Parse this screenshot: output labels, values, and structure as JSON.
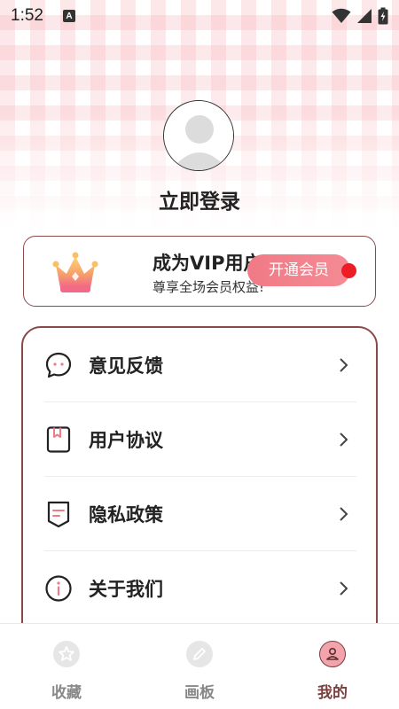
{
  "status_bar": {
    "time": "1:52",
    "notification_icon": "text-a-icon",
    "icons": [
      "wifi-icon",
      "signal-icon",
      "battery-charging-icon"
    ]
  },
  "profile": {
    "avatar_icon": "default-avatar-icon",
    "login_label": "立即登录"
  },
  "vip_card": {
    "title": "成为VIP用户",
    "subtitle": "尊享全场会员权益!",
    "button_label": "开通会员",
    "icon": "crown-icon"
  },
  "menu": {
    "items": [
      {
        "label": "意见反馈",
        "icon": "chat-bubble-icon"
      },
      {
        "label": "用户协议",
        "icon": "bookmark-document-icon"
      },
      {
        "label": "隐私政策",
        "icon": "shield-document-icon"
      },
      {
        "label": "关于我们",
        "icon": "info-icon"
      }
    ]
  },
  "tab_bar": {
    "tabs": [
      {
        "label": "收藏",
        "icon": "star-icon",
        "active": false
      },
      {
        "label": "画板",
        "icon": "pencil-icon",
        "active": false
      },
      {
        "label": "我的",
        "icon": "person-icon",
        "active": true
      }
    ]
  },
  "colors": {
    "accent": "#8a4a4a",
    "vip_button": "#f07a86",
    "red_dot": "#ee1c25",
    "active_tab": "#7a3f3f",
    "inactive_tab": "#888888"
  }
}
